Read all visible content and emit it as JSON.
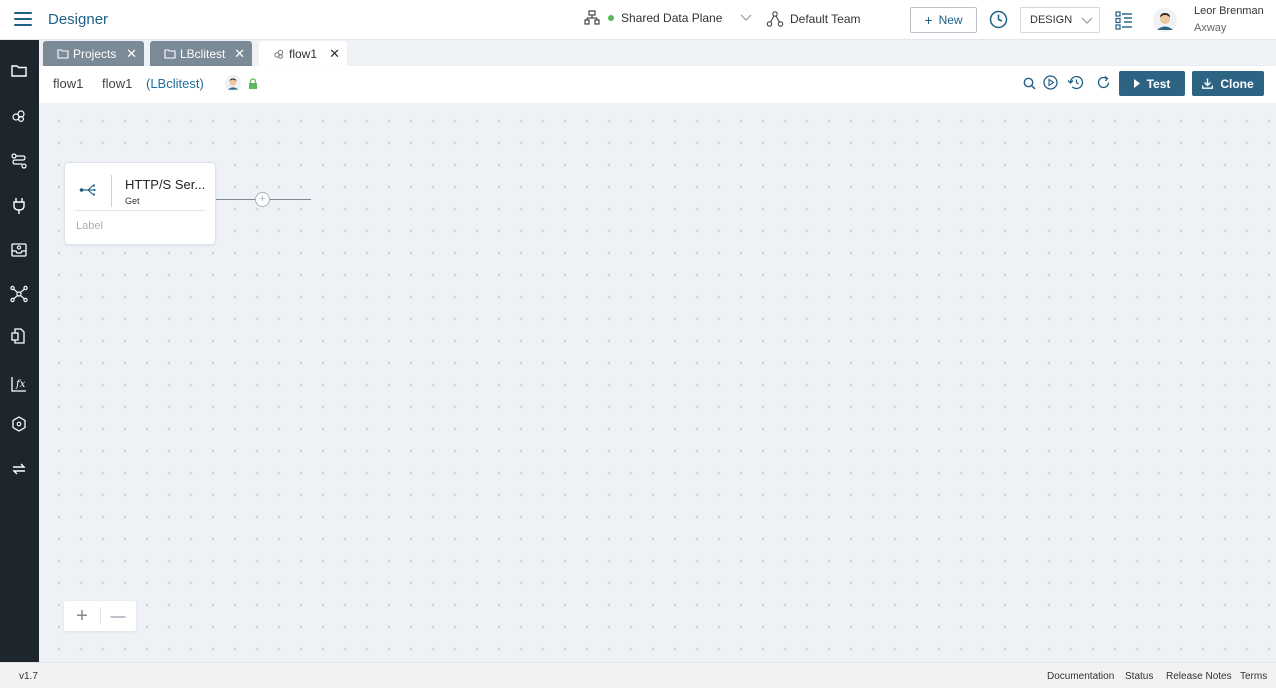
{
  "app": {
    "title": "Designer"
  },
  "header": {
    "data_plane": "Shared Data Plane",
    "team": "Default Team",
    "new_label": "New",
    "mode": "DESIGN",
    "user_name": "Leor Brenman",
    "user_org": "Axway"
  },
  "colors": {
    "brand": "#1f5f85",
    "nav_bg": "#1d252d",
    "button": "#2d6383",
    "status_ok": "#5cb85c"
  },
  "nav": {
    "items": [
      "folder-icon",
      "integration-icon",
      "flow-icon",
      "plug-icon",
      "inbox-icon",
      "network-icon",
      "document-icon",
      "function-icon",
      "hexagon-icon",
      "swap-icon"
    ]
  },
  "tabs": [
    {
      "label": "Projects",
      "icon": "folder-icon"
    },
    {
      "label": "LBclitest",
      "icon": "folder-icon"
    },
    {
      "label": "flow1",
      "icon": "flow-icon"
    }
  ],
  "breadcrumb": {
    "flow_name": "flow1",
    "flow_label": "flow1",
    "project": "(LBclitest)"
  },
  "toolbar": {
    "test_label": "Test",
    "clone_label": "Clone"
  },
  "canvas": {
    "node": {
      "title": "HTTP/S Ser...",
      "subtitle": "Get",
      "label": "Label"
    },
    "zoom_in": "+",
    "zoom_out": "—"
  },
  "footer": {
    "version": "v1.7",
    "links": [
      "Documentation",
      "Status",
      "Release Notes",
      "Terms"
    ]
  }
}
